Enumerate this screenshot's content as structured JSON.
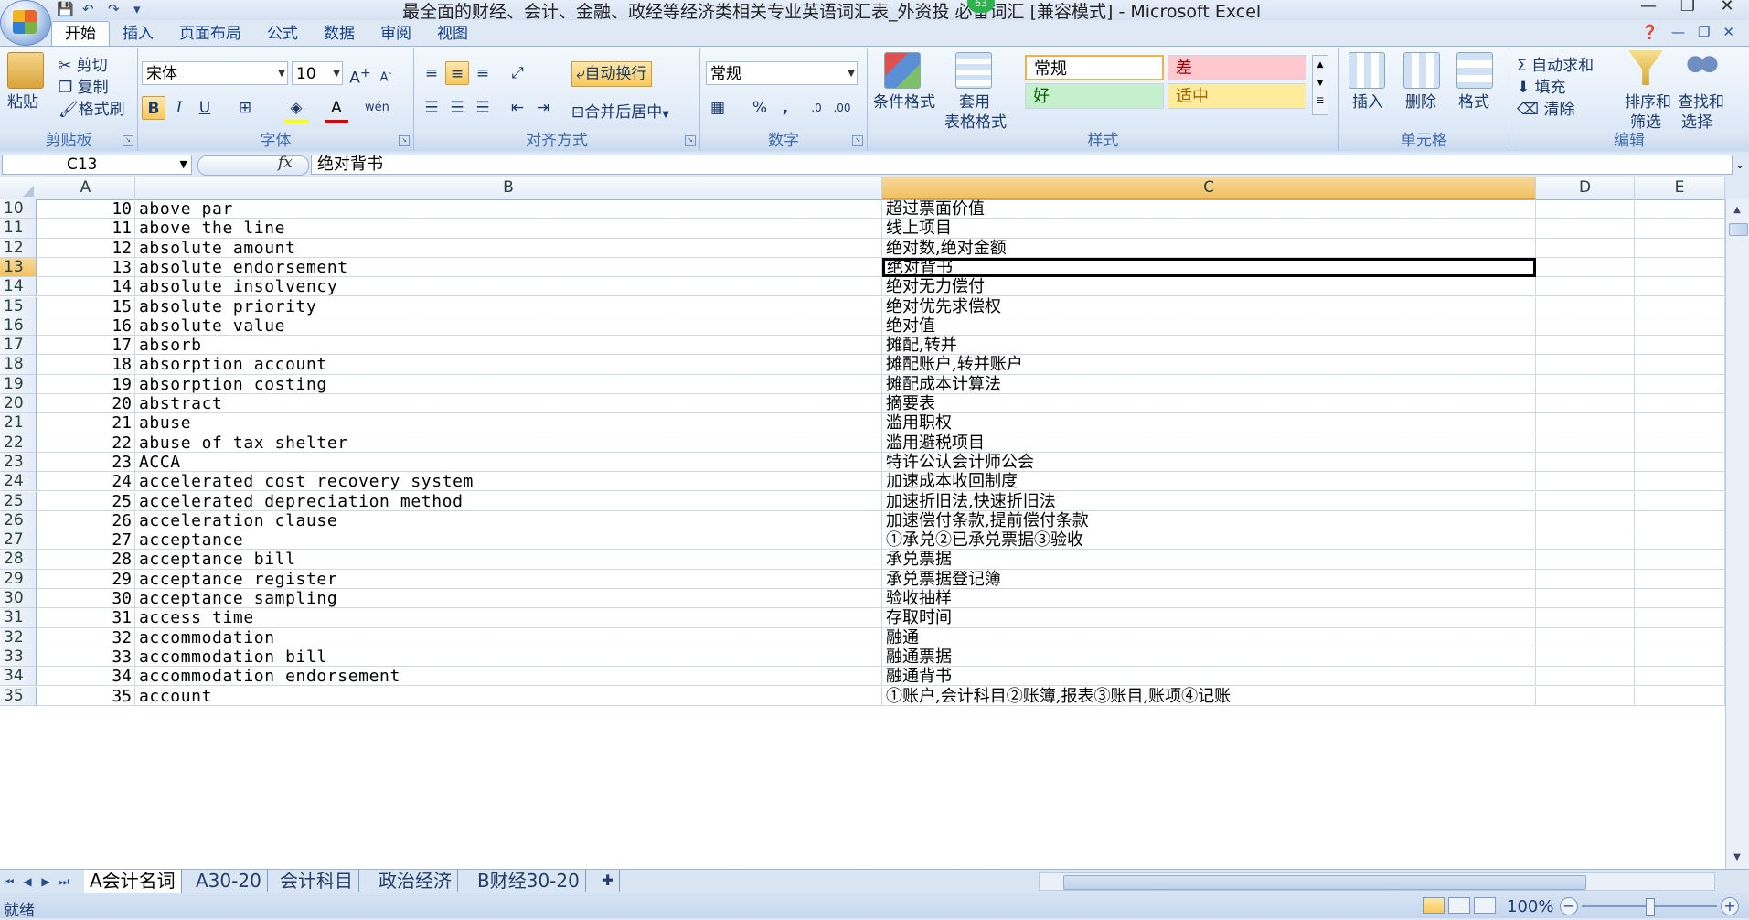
{
  "window": {
    "title": "最全面的财经、会计、金融、政经等经济类相关专业英语词汇表_外资投 必备词汇  [兼容模式] - Microsoft Excel",
    "notification_badge": "63",
    "minimize": "—",
    "restore": "❐",
    "close": "✕"
  },
  "ribbon_tabs": [
    "开始",
    "插入",
    "页面布局",
    "公式",
    "数据",
    "审阅",
    "视图"
  ],
  "ribbon": {
    "clipboard": {
      "label": "剪贴板",
      "paste": "粘贴",
      "cut": "剪切",
      "copy": "复制",
      "format_painter": "格式刷"
    },
    "font": {
      "label": "字体",
      "font_name": "宋体",
      "font_size": "10",
      "bold": "B",
      "italic": "I",
      "underline": "U"
    },
    "alignment": {
      "label": "对齐方式",
      "wrap_text": "自动换行",
      "merge_center": "合并后居中"
    },
    "number": {
      "label": "数字",
      "format": "常规",
      "percent": "%",
      "comma": ","
    },
    "styles": {
      "label": "样式",
      "conditional_format": "条件格式",
      "table_format_1": "套用",
      "table_format_2": "表格格式",
      "normal": "常规",
      "bad": "差",
      "good": "好",
      "neutral": "适中"
    },
    "cells": {
      "label": "单元格",
      "insert": "插入",
      "delete": "删除",
      "format": "格式"
    },
    "editing": {
      "label": "编辑",
      "autosum": "自动求和",
      "fill": "填充",
      "clear": "清除",
      "sort_filter_1": "排序和",
      "sort_filter_2": "筛选",
      "find_select_1": "查找和",
      "find_select_2": "选择"
    }
  },
  "formula_bar": {
    "name_box": "C13",
    "fx": "fx",
    "formula": "绝对背书"
  },
  "columns": [
    "A",
    "B",
    "C",
    "D",
    "E"
  ],
  "selected_column": "C",
  "selected_row": "13",
  "rows": [
    {
      "n": "10",
      "a": "10",
      "b": "above par",
      "c": "超过票面价值"
    },
    {
      "n": "11",
      "a": "11",
      "b": "above the line",
      "c": "线上项目"
    },
    {
      "n": "12",
      "a": "12",
      "b": "absolute amount",
      "c": "绝对数,绝对金额"
    },
    {
      "n": "13",
      "a": "13",
      "b": "absolute endorsement",
      "c": "绝对背书"
    },
    {
      "n": "14",
      "a": "14",
      "b": "absolute insolvency",
      "c": "绝对无力偿付"
    },
    {
      "n": "15",
      "a": "15",
      "b": "absolute priority",
      "c": "绝对优先求偿权"
    },
    {
      "n": "16",
      "a": "16",
      "b": "absolute value",
      "c": "绝对值"
    },
    {
      "n": "17",
      "a": "17",
      "b": "absorb",
      "c": "摊配,转并"
    },
    {
      "n": "18",
      "a": "18",
      "b": "absorption account",
      "c": "摊配账户,转并账户"
    },
    {
      "n": "19",
      "a": "19",
      "b": "absorption costing",
      "c": "摊配成本计算法"
    },
    {
      "n": "20",
      "a": "20",
      "b": "abstract",
      "c": "摘要表"
    },
    {
      "n": "21",
      "a": "21",
      "b": "abuse",
      "c": "滥用职权"
    },
    {
      "n": "22",
      "a": "22",
      "b": "abuse of tax shelter",
      "c": "滥用避税项目"
    },
    {
      "n": "23",
      "a": "23",
      "b": "ACCA",
      "c": "特许公认会计师公会"
    },
    {
      "n": "24",
      "a": "24",
      "b": "accelerated cost recovery system",
      "c": "加速成本收回制度"
    },
    {
      "n": "25",
      "a": "25",
      "b": "accelerated depreciation method",
      "c": "加速折旧法,快速折旧法"
    },
    {
      "n": "26",
      "a": "26",
      "b": "acceleration clause",
      "c": "加速偿付条款,提前偿付条款"
    },
    {
      "n": "27",
      "a": "27",
      "b": "acceptance",
      "c": "①承兑②已承兑票据③验收"
    },
    {
      "n": "28",
      "a": "28",
      "b": "acceptance bill",
      "c": "承兑票据"
    },
    {
      "n": "29",
      "a": "29",
      "b": "acceptance register",
      "c": "承兑票据登记簿"
    },
    {
      "n": "30",
      "a": "30",
      "b": "acceptance sampling",
      "c": "验收抽样"
    },
    {
      "n": "31",
      "a": "31",
      "b": "access time",
      "c": "存取时间"
    },
    {
      "n": "32",
      "a": "32",
      "b": "accommodation",
      "c": "融通"
    },
    {
      "n": "33",
      "a": "33",
      "b": "accommodation bill",
      "c": "融通票据"
    },
    {
      "n": "34",
      "a": "34",
      "b": "accommodation endorsement",
      "c": "融通背书"
    },
    {
      "n": "35",
      "a": "35",
      "b": "account",
      "c": "①账户,会计科目②账簿,报表③账目,账项④记账"
    }
  ],
  "sheet_tabs": [
    "A会计名词",
    "A30-20",
    "会计科目",
    "政治经济",
    "B财经30-20"
  ],
  "active_sheet": "A会计名词",
  "status": {
    "text": "就绪",
    "zoom": "100%"
  },
  "colors": {
    "selection_header": "#f1c15f",
    "ribbon_bg": "#dfe8f5",
    "good_fill": "#c6efce",
    "bad_fill": "#ffc7ce",
    "neutral_fill": "#ffeb9c"
  }
}
